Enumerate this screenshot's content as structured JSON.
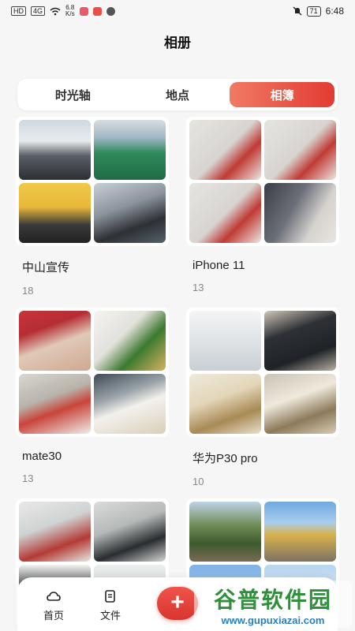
{
  "status_bar": {
    "left_chips": [
      "HD",
      "4G"
    ],
    "net_speed": "6.8\nK/s",
    "battery": "71",
    "time": "6:48"
  },
  "header": {
    "title": "相册"
  },
  "tabs": [
    {
      "label": "时光轴",
      "active": false
    },
    {
      "label": "地点",
      "active": false
    },
    {
      "label": "相簿",
      "active": true
    }
  ],
  "albums": [
    {
      "name": "中山宣传",
      "count": "18"
    },
    {
      "name": "iPhone 11",
      "count": "13"
    },
    {
      "name": "mate30",
      "count": "13"
    },
    {
      "name": "华为P30 pro",
      "count": "10"
    },
    {
      "name": "",
      "count": ""
    },
    {
      "name": "",
      "count": ""
    }
  ],
  "bottom_nav": {
    "home_label": "首页",
    "files_label": "文件",
    "fab_label": "+"
  },
  "watermark": {
    "title": "谷普软件园",
    "url": "www.gupuxiazai.com"
  },
  "colors": {
    "accent": "#e23b33",
    "accent_light": "#f07a62"
  }
}
